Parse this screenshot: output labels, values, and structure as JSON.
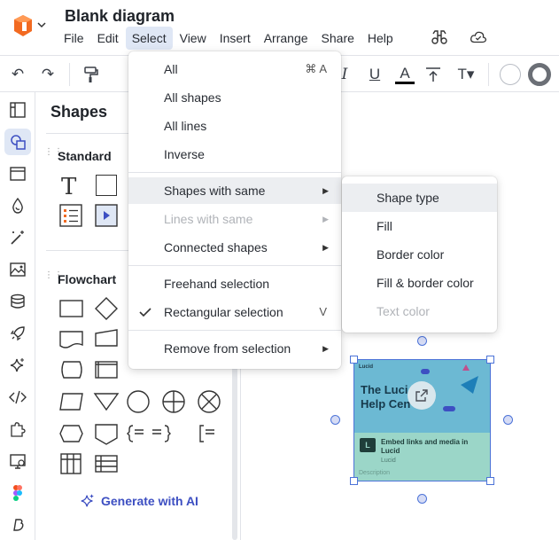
{
  "header": {
    "title": "Blank diagram",
    "menus": [
      "File",
      "Edit",
      "Select",
      "View",
      "Insert",
      "Arrange",
      "Share",
      "Help"
    ],
    "active_menu": "Select"
  },
  "panel": {
    "title": "Shapes",
    "sections": [
      "Standard",
      "Flowchart"
    ],
    "generate_label": "Generate with AI"
  },
  "select_menu": {
    "items": [
      {
        "label": "All",
        "shortcut": "⌘ A"
      },
      {
        "label": "All shapes"
      },
      {
        "label": "All lines"
      },
      {
        "label": "Inverse"
      },
      {
        "label": "Shapes with same",
        "submenu": true,
        "highlighted": true
      },
      {
        "label": "Lines with same",
        "submenu": true,
        "disabled": true
      },
      {
        "label": "Connected shapes",
        "submenu": true
      },
      {
        "label": "Freehand selection"
      },
      {
        "label": "Rectangular selection",
        "shortcut": "V",
        "checked": true
      },
      {
        "label": "Remove from selection",
        "submenu": true
      }
    ]
  },
  "submenu": {
    "items": [
      {
        "label": "Shape type",
        "highlighted": true
      },
      {
        "label": "Fill"
      },
      {
        "label": "Border color"
      },
      {
        "label": "Fill & border color"
      },
      {
        "label": "Text color",
        "disabled": true
      }
    ]
  },
  "image_card": {
    "brand": "Lucid",
    "headline": "The Luci\nHelp Cen",
    "embed_title": "Embed links and media in Lucid",
    "embed_source": "Lucid",
    "embed_desc": "Description"
  },
  "colors": {
    "accent": "#3d4fc2",
    "highlight": "#dfe7f5",
    "logo_orange": "#f26a21"
  }
}
